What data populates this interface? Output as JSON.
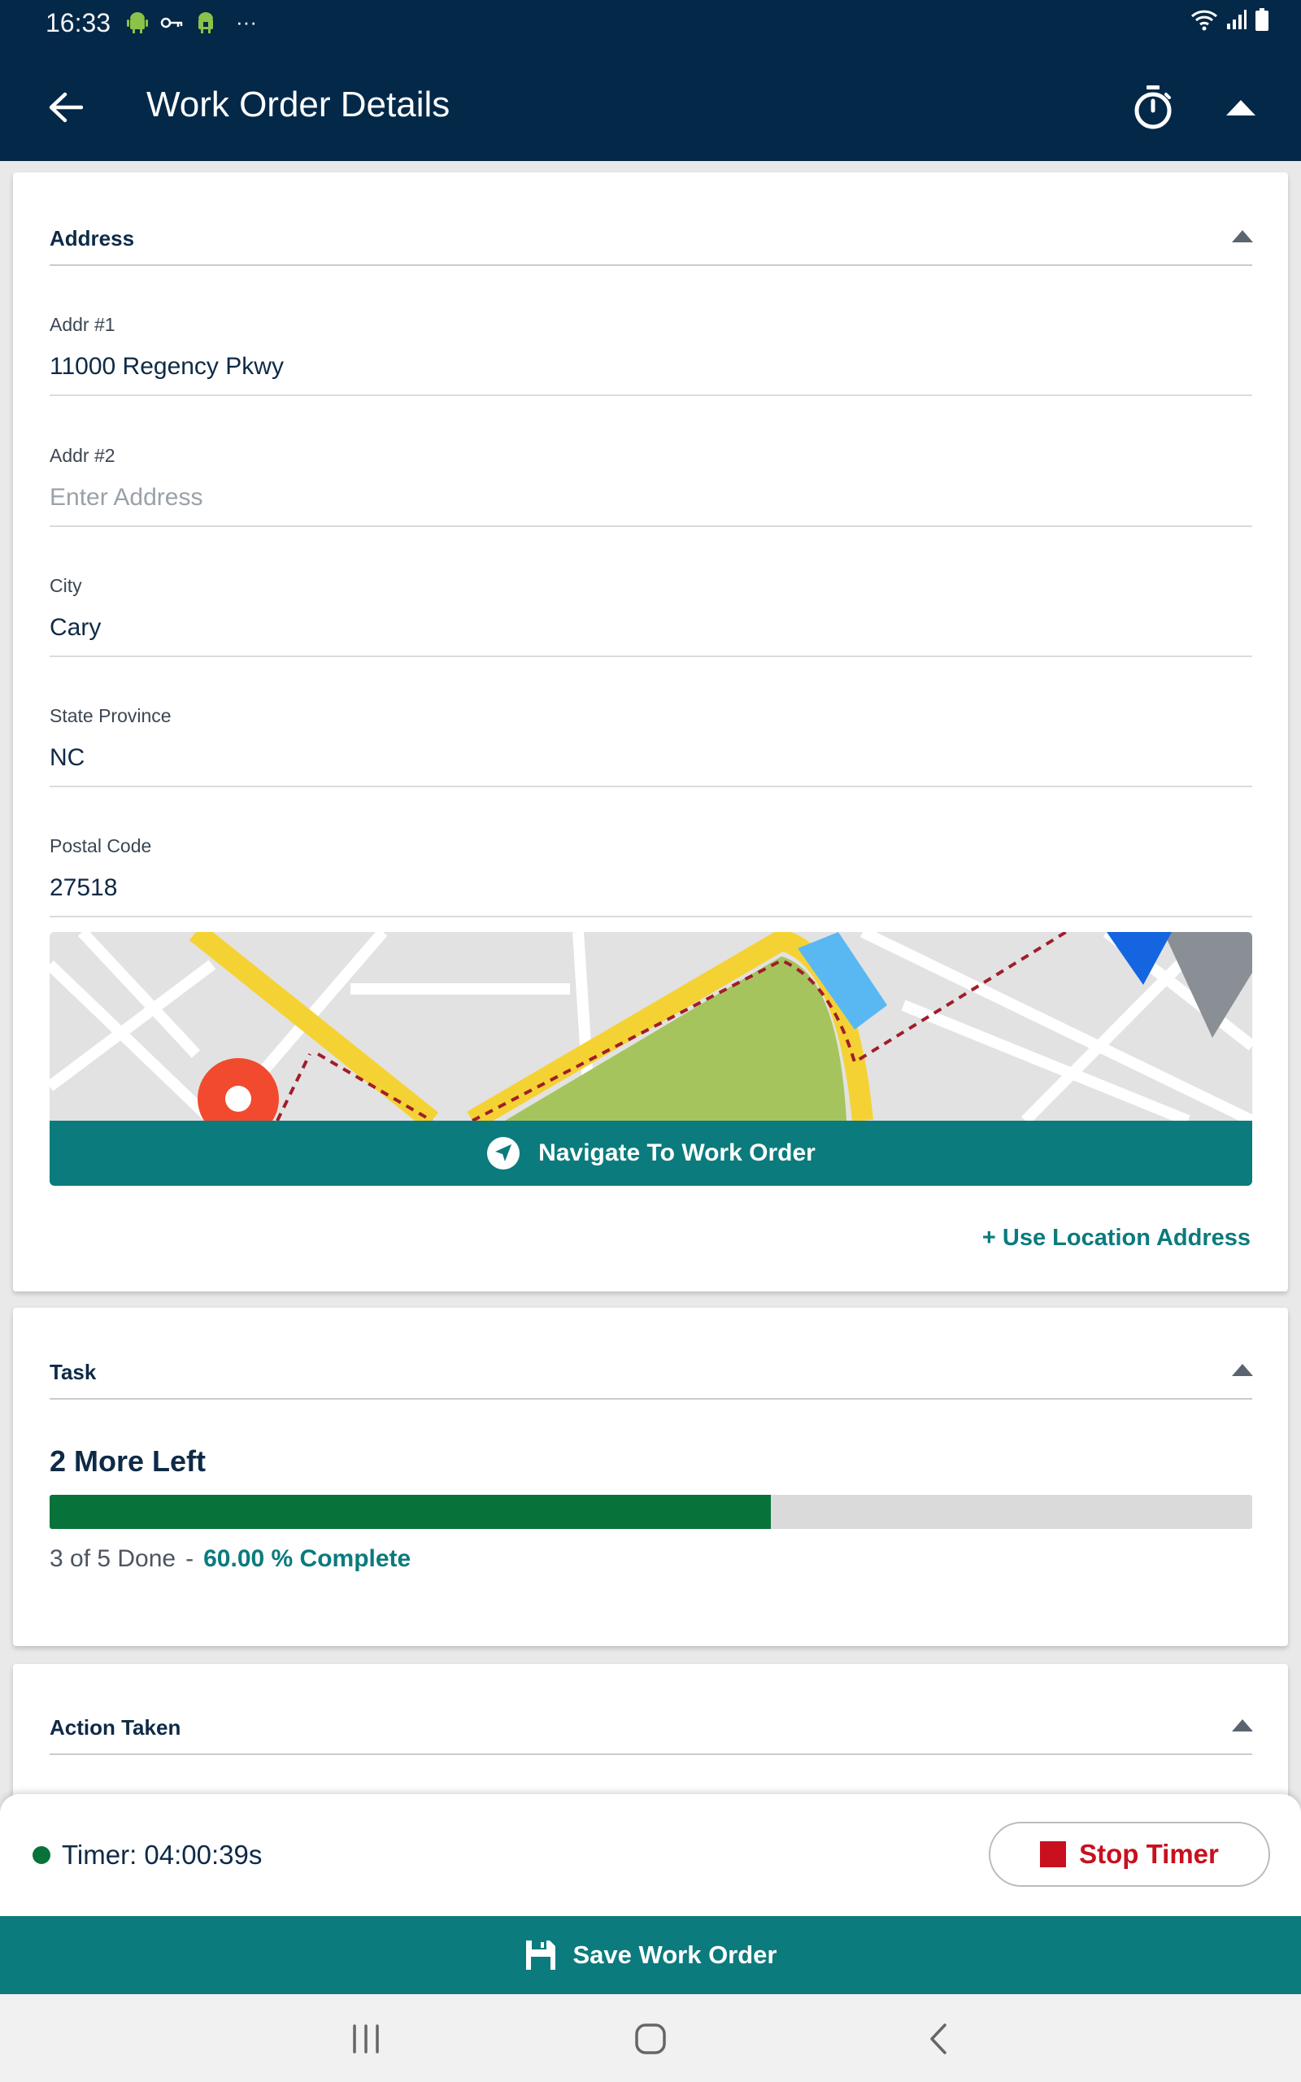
{
  "status_bar": {
    "time": "16:33",
    "overflow": "···"
  },
  "app_bar": {
    "title": "Work Order Details"
  },
  "address_section": {
    "title": "Address",
    "fields": [
      {
        "label": "Addr #1",
        "value": "11000 Regency Pkwy",
        "placeholder": ""
      },
      {
        "label": "Addr #2",
        "value": "",
        "placeholder": "Enter Address"
      },
      {
        "label": "City",
        "value": "Cary",
        "placeholder": ""
      },
      {
        "label": "State Province",
        "value": "NC",
        "placeholder": ""
      },
      {
        "label": "Postal Code",
        "value": "27518",
        "placeholder": ""
      }
    ],
    "navigate_label": "Navigate To Work Order",
    "use_location_label": "+ Use Location Address"
  },
  "task_section": {
    "title": "Task",
    "remaining": "2 More Left",
    "done_text": "3 of 5 Done",
    "separator": "-",
    "percent_text": "60.00 % Complete",
    "progress_fraction": 0.6
  },
  "action_section": {
    "title": "Action Taken"
  },
  "timer_panel": {
    "timer_text": "Timer: 04:00:39s",
    "stop_label": "Stop Timer"
  },
  "save_label": "Save Work Order",
  "colors": {
    "header_bg": "#032848",
    "teal": "#0b7b7d",
    "progress_green": "#07733b",
    "stop_red": "#c8101e"
  },
  "icons": {
    "back": "arrow-left-icon",
    "timer": "stopwatch-icon",
    "collapse": "chevron-up-icon",
    "navigate": "navigation-arrow-icon",
    "save": "floppy-disk-icon",
    "stop": "stop-square-icon"
  }
}
